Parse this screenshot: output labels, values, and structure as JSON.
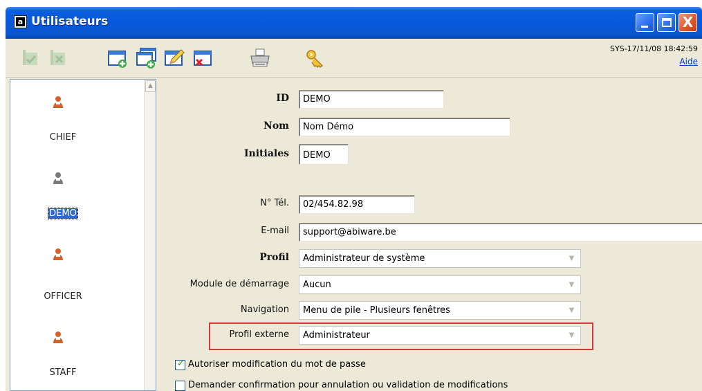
{
  "window": {
    "title": "Utilisateurs",
    "app_icon_letter": "a",
    "close_glyph": "X"
  },
  "toolbar": {
    "timestamp": "SYS-17/11/08 18:42:59",
    "help_label": "Aide",
    "icons": [
      "save-icon",
      "save-close-icon",
      "new-record-icon",
      "copy-record-icon",
      "edit-icon",
      "delete-icon",
      "print-icon",
      "key-icon"
    ]
  },
  "users": [
    {
      "name": "CHIEF",
      "selected": false,
      "color": "#d4622d"
    },
    {
      "name": "DEMO",
      "selected": true,
      "color": "#7a7a7a"
    },
    {
      "name": "OFFICER",
      "selected": false,
      "color": "#d4622d"
    },
    {
      "name": "STAFF",
      "selected": false,
      "color": "#d4622d"
    }
  ],
  "form": {
    "id_label": "ID",
    "id_value": "DEMO",
    "name_label": "Nom",
    "name_value": "Nom Démo",
    "initials_label": "Initiales",
    "initials_value": "DEMO",
    "phone_label": "N° Tél.",
    "phone_value": "02/454.82.98",
    "email_label": "E-mail",
    "email_value": "support@abiware.be",
    "profile_label": "Profil",
    "profile_value": "Administrateur de système",
    "start_module_label": "Module de démarrage",
    "start_module_value": "Aucun",
    "navigation_label": "Navigation",
    "navigation_value": "Menu de pile - Plusieurs fenêtres",
    "external_profile_label": "Profil externe",
    "external_profile_value": "Administrateur",
    "allow_password_change_label": "Autoriser modification du mot de passe",
    "allow_password_change_checked": true,
    "confirm_changes_label": "Demander confirmation pour annulation ou validation de modifications",
    "confirm_changes_checked": false
  },
  "colors": {
    "titlebar": "#0858db",
    "highlight_frame": "#d33b3b",
    "selection": "#3169c6",
    "link": "#0033cc"
  }
}
